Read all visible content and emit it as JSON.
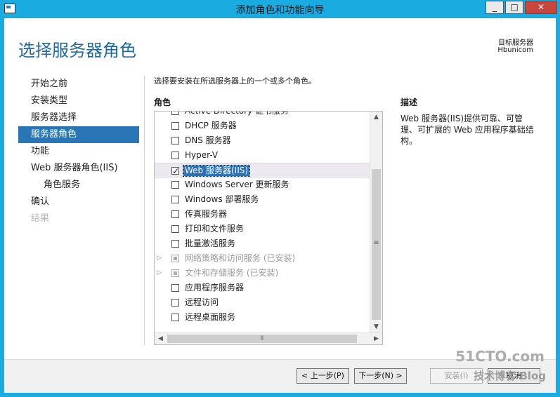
{
  "window": {
    "title": "添加角色和功能向导",
    "minimize": "_",
    "maximize": "□",
    "close": "✕"
  },
  "page": {
    "title": "选择服务器角色",
    "dest_label": "目标服务器",
    "dest_name": "Hbunicom"
  },
  "nav": {
    "items": [
      {
        "label": "开始之前"
      },
      {
        "label": "安装类型"
      },
      {
        "label": "服务器选择"
      },
      {
        "label": "服务器角色"
      },
      {
        "label": "功能"
      },
      {
        "label": "Web 服务器角色(IIS)"
      },
      {
        "label": "角色服务"
      },
      {
        "label": "确认"
      },
      {
        "label": "结果"
      }
    ]
  },
  "content": {
    "instruction": "选择要安装在所选服务器上的一个或多个角色。",
    "roles_header": "角色",
    "roles": [
      {
        "label": "Active Directory 证书服务"
      },
      {
        "label": "DHCP 服务器"
      },
      {
        "label": "DNS 服务器"
      },
      {
        "label": "Hyper-V"
      },
      {
        "label": "Web 服务器(IIS)"
      },
      {
        "label": "Windows Server 更新服务"
      },
      {
        "label": "Windows 部署服务"
      },
      {
        "label": "传真服务器"
      },
      {
        "label": "打印和文件服务"
      },
      {
        "label": "批量激活服务"
      },
      {
        "label": "网络策略和访问服务 (已安装)"
      },
      {
        "label": "文件和存储服务 (已安装)"
      },
      {
        "label": "应用程序服务器"
      },
      {
        "label": "远程访问"
      },
      {
        "label": "远程桌面服务"
      }
    ]
  },
  "description": {
    "header": "描述",
    "text": "Web 服务器(IIS)提供可靠、可管理、可扩展的 Web 应用程序基础结构。"
  },
  "buttons": {
    "prev": "< 上一步(P)",
    "next": "下一步(N) >",
    "install": "安装(I)",
    "cancel": "取消"
  },
  "watermark": {
    "line1": "51CTO.com",
    "line2": "技术博客 Blog"
  }
}
